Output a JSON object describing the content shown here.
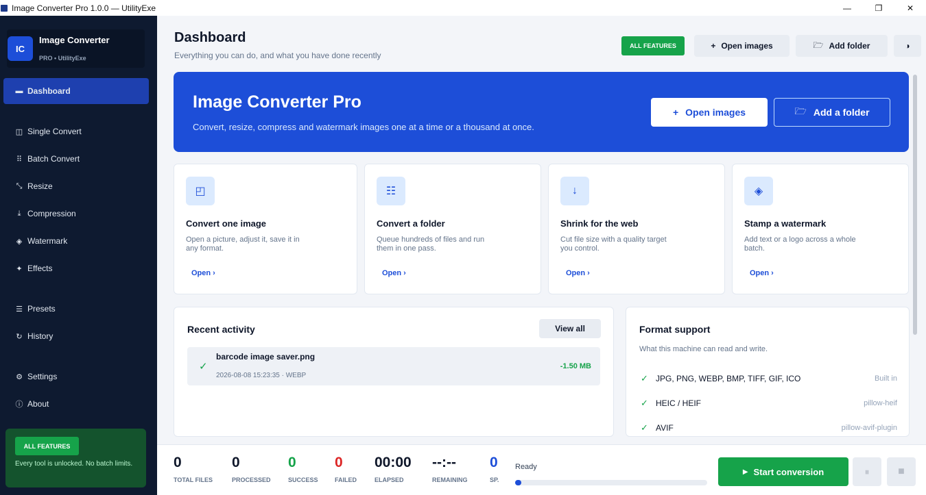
{
  "window": {
    "title": "Image Converter Pro 1.0.0 — UtilityExe",
    "minimize": "—",
    "maximize": "❐",
    "close": "✕"
  },
  "brand": {
    "logo": "IC",
    "name": "Image Converter",
    "sub": "PRO  •  UtilityExe"
  },
  "sidebar": {
    "items": [
      {
        "label": "Dashboard",
        "icon": "dashboard-icon",
        "glyph": "▬"
      },
      {
        "label": "Single Convert",
        "icon": "single-convert-icon",
        "glyph": "◫"
      },
      {
        "label": "Batch Convert",
        "icon": "batch-grid-icon",
        "glyph": "⠿"
      },
      {
        "label": "Resize",
        "icon": "resize-icon",
        "glyph": "⤡"
      },
      {
        "label": "Compression",
        "icon": "compression-icon",
        "glyph": "⤓"
      },
      {
        "label": "Watermark",
        "icon": "watermark-icon",
        "glyph": "◈"
      },
      {
        "label": "Effects",
        "icon": "effects-icon",
        "glyph": "✦"
      },
      {
        "label": "Presets",
        "icon": "presets-icon",
        "glyph": "☰"
      },
      {
        "label": "History",
        "icon": "history-icon",
        "glyph": "↻"
      },
      {
        "label": "Settings",
        "icon": "settings-gear-icon",
        "glyph": "⚙"
      },
      {
        "label": "About",
        "icon": "about-info-icon",
        "glyph": "ⓘ"
      }
    ],
    "promo": {
      "badge": "ALL FEATURES",
      "text": "Every tool is unlocked. No batch limits."
    }
  },
  "header": {
    "title": "Dashboard",
    "subtitle": "Everything you can do, and what you have done recently",
    "badge": "ALL FEATURES",
    "open_images": "Open images",
    "open_images_glyph": "+",
    "add_folder": "Add folder",
    "add_folder_glyph": "🗁",
    "theme_glyph": "◑"
  },
  "hero": {
    "title": "Image Converter Pro",
    "subtitle": "Convert, resize, compress and watermark images one at a time or a thousand at once.",
    "open_images": "Open images",
    "open_glyph": "+",
    "add_folder": "Add a folder",
    "folder_glyph": "🗁"
  },
  "cards": [
    {
      "title": "Convert one image",
      "desc": "Open a picture, adjust it, save it in any format.",
      "link": "Open ›",
      "glyph": "◰"
    },
    {
      "title": "Convert a folder",
      "desc": "Queue hundreds of files and run them in one pass.",
      "link": "Open ›",
      "glyph": "☷"
    },
    {
      "title": "Shrink for the web",
      "desc": "Cut file size with a quality target you control.",
      "link": "Open ›",
      "glyph": "↓"
    },
    {
      "title": "Stamp a watermark",
      "desc": "Add text or a logo across a whole batch.",
      "link": "Open ›",
      "glyph": "◈"
    }
  ],
  "recent": {
    "title": "Recent activity",
    "view_all": "View all",
    "items": [
      {
        "check": "✓",
        "name": "barcode image saver.png",
        "meta": "2026-08-08 15:23:35  ·  WEBP",
        "size": "-1.50 MB"
      }
    ]
  },
  "formats": {
    "title": "Format support",
    "subtitle": "What this machine can read and write.",
    "rows": [
      {
        "check": "✓",
        "name": "JPG, PNG, WEBP, BMP, TIFF, GIF, ICO",
        "source": "Built in"
      },
      {
        "check": "✓",
        "name": "HEIC / HEIF",
        "source": "pillow-heif"
      },
      {
        "check": "✓",
        "name": "AVIF",
        "source": "pillow-avif-plugin"
      }
    ]
  },
  "status": {
    "stats": [
      {
        "value": "0",
        "label": "TOTAL FILES",
        "color": "#0f172a"
      },
      {
        "value": "0",
        "label": "PROCESSED",
        "color": "#0f172a"
      },
      {
        "value": "0",
        "label": "SUCCESS",
        "color": "#16a34a"
      },
      {
        "value": "0",
        "label": "FAILED",
        "color": "#dc2626"
      },
      {
        "value": "00:00",
        "label": "ELAPSED",
        "color": "#0f172a"
      },
      {
        "value": "--:--",
        "label": "REMAINING",
        "color": "#0f172a"
      },
      {
        "value": "0",
        "label": "SP.",
        "color": "#1d4ed8"
      }
    ],
    "ready": "Ready",
    "progress": 0,
    "start": "Start conversion",
    "start_glyph": "▶",
    "pause_glyph": "⏸",
    "stop_glyph": "■"
  },
  "colors": {
    "accent": "#1d4ed8",
    "success": "#16a34a",
    "danger": "#dc2626",
    "sidebar": "#0e1a30"
  }
}
